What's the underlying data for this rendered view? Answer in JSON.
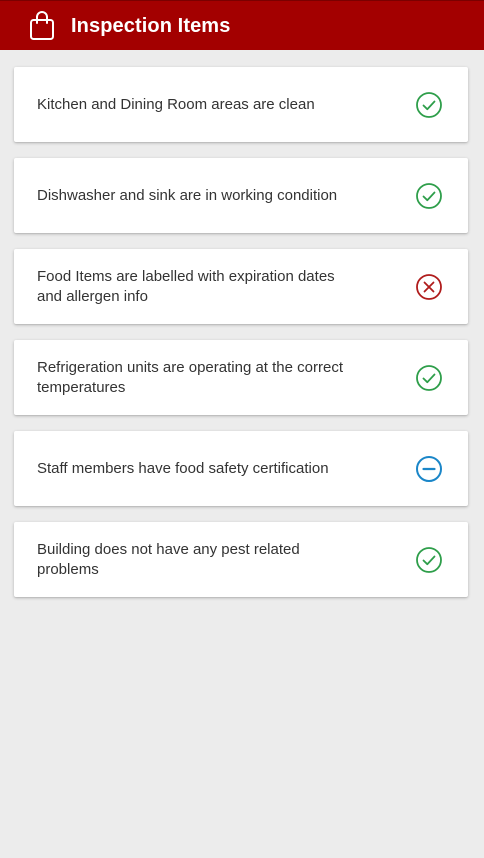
{
  "header": {
    "title": "Inspection Items",
    "icon": "shopping-bag-icon",
    "background_color": "#a30000"
  },
  "items": [
    {
      "label": "Kitchen and Dining Room areas are clean",
      "status": "pass",
      "icon": "check-circle-icon"
    },
    {
      "label": "Dishwasher and sink are in working condition",
      "status": "pass",
      "icon": "check-circle-icon"
    },
    {
      "label": "Food Items are labelled with expiration dates and allergen info",
      "status": "fail",
      "icon": "x-circle-icon"
    },
    {
      "label": "Refrigeration units are operating at the correct temperatures",
      "status": "pass",
      "icon": "check-circle-icon"
    },
    {
      "label": "Staff members have food safety certification",
      "status": "not-applicable",
      "icon": "minus-circle-icon"
    },
    {
      "label": "Building does not have any pest related problems",
      "status": "pass",
      "icon": "check-circle-icon"
    }
  ],
  "colors": {
    "pass": "#2e9e4a",
    "fail": "#b01c1c",
    "not-applicable": "#1a86c8",
    "background": "#ececec"
  }
}
